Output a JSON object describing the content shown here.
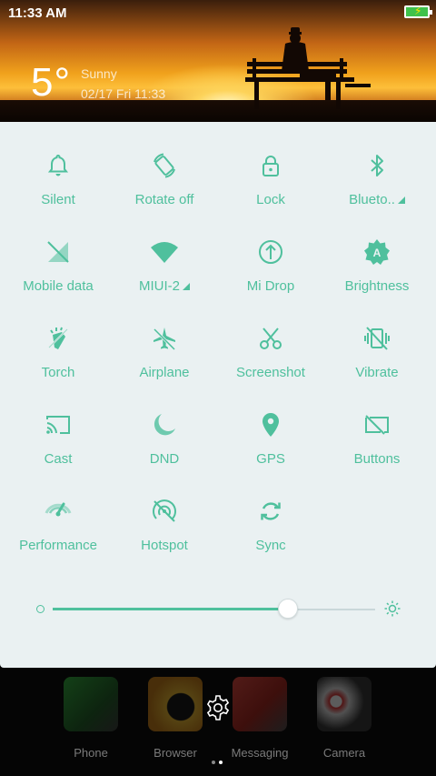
{
  "status_bar": {
    "time": "11:33 AM"
  },
  "weather": {
    "temperature": "5°",
    "condition": "Sunny",
    "datetime": "02/17 Fri 11:33"
  },
  "colors": {
    "accent": "#4fc09d",
    "panel_bg": "#eaf1f2"
  },
  "tiles": [
    {
      "label": "Silent",
      "icon": "bell-icon"
    },
    {
      "label": "Rotate off",
      "icon": "rotate-icon"
    },
    {
      "label": "Lock",
      "icon": "lock-icon"
    },
    {
      "label": "Blueto..",
      "icon": "bluetooth-icon",
      "has_menu": true
    },
    {
      "label": "Mobile data",
      "icon": "mobile-data-icon"
    },
    {
      "label": "MIUI-2",
      "icon": "wifi-icon",
      "has_menu": true
    },
    {
      "label": "Mi Drop",
      "icon": "mi-drop-icon"
    },
    {
      "label": "Brightness",
      "icon": "auto-brightness-icon"
    },
    {
      "label": "Torch",
      "icon": "torch-icon"
    },
    {
      "label": "Airplane",
      "icon": "airplane-icon"
    },
    {
      "label": "Screenshot",
      "icon": "scissors-icon"
    },
    {
      "label": "Vibrate",
      "icon": "vibrate-icon"
    },
    {
      "label": "Cast",
      "icon": "cast-icon"
    },
    {
      "label": "DND",
      "icon": "moon-icon"
    },
    {
      "label": "GPS",
      "icon": "location-pin-icon"
    },
    {
      "label": "Buttons",
      "icon": "buttons-icon"
    },
    {
      "label": "Performance",
      "icon": "performance-icon"
    },
    {
      "label": "Hotspot",
      "icon": "hotspot-icon"
    },
    {
      "label": "Sync",
      "icon": "sync-icon"
    }
  ],
  "brightness": {
    "level": 0.73
  },
  "dock": {
    "apps": [
      {
        "label": "Phone"
      },
      {
        "label": "Browser"
      },
      {
        "label": "Messaging"
      },
      {
        "label": "Camera"
      }
    ]
  }
}
